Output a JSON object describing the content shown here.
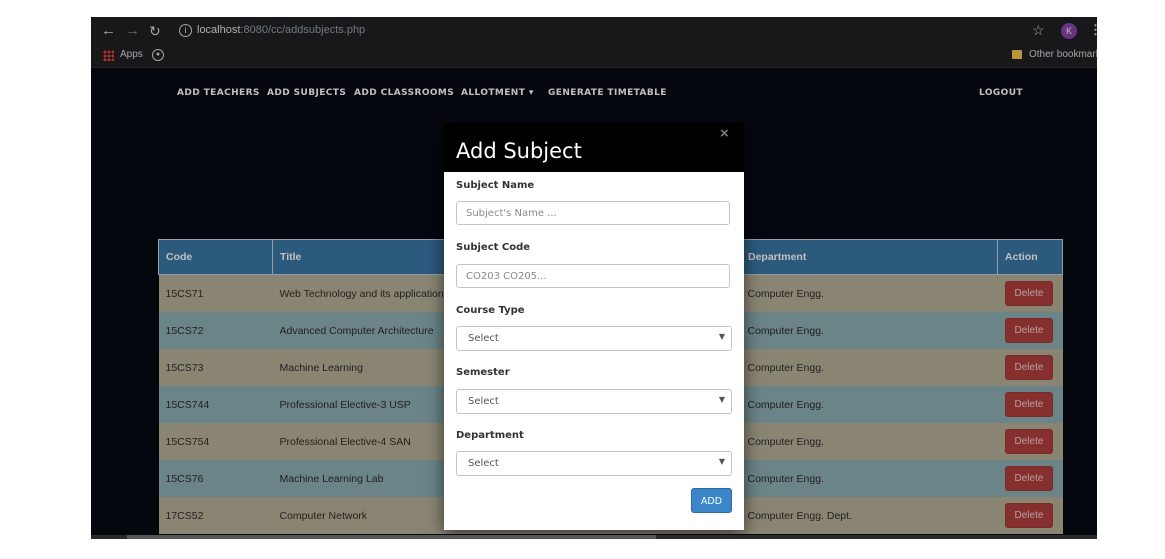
{
  "browser": {
    "url_host": "localhost",
    "url_path": ":8080/cc/addsubjects.php",
    "apps_label": "Apps",
    "other_bookmarks": "Other bookmarks",
    "avatar_letter": "K"
  },
  "nav": {
    "items": [
      "ADD TEACHERS",
      "ADD SUBJECTS",
      "ADD CLASSROOMS",
      "ALLOTMENT ▾",
      "GENERATE TIMETABLE"
    ],
    "logout": "LOGOUT"
  },
  "table": {
    "headers": [
      "Code",
      "Title",
      "Department",
      "Action"
    ],
    "rows": [
      {
        "code": "15CS71",
        "title": "Web Technology and its applications",
        "department": "Computer Engg.",
        "action": "Delete"
      },
      {
        "code": "15CS72",
        "title": "Advanced Computer Architecture",
        "department": "Computer Engg.",
        "action": "Delete"
      },
      {
        "code": "15CS73",
        "title": "Machine Learning",
        "department": "Computer Engg.",
        "action": "Delete"
      },
      {
        "code": "15CS744",
        "title": "Professional Elective-3 USP",
        "department": "Computer Engg.",
        "action": "Delete"
      },
      {
        "code": "15CS754",
        "title": "Professional Elective-4 SAN",
        "department": "Computer Engg.",
        "action": "Delete"
      },
      {
        "code": "15CS76",
        "title": "Machine Learning Lab",
        "department": "Computer Engg.",
        "action": "Delete"
      },
      {
        "code": "17CS52",
        "title": "Computer Network",
        "department": "Computer Engg. Dept.",
        "action": "Delete"
      }
    ]
  },
  "modal": {
    "title": "Add Subject",
    "close": "×",
    "subject_name_label": "Subject Name",
    "subject_name_placeholder": "Subject's Name ...",
    "subject_code_label": "Subject Code",
    "subject_code_placeholder": "CO203 CO205...",
    "course_type_label": "Course Type",
    "course_type_value": "Select",
    "semester_label": "Semester",
    "semester_value": "Select",
    "department_label": "Department",
    "department_value": "Select",
    "add_label": "ADD"
  },
  "colors": {
    "page_bg": "#070a15",
    "table_header": "#3b79a7",
    "row_tan": "#b9b29a",
    "row_teal": "#8fb0b5",
    "delete_button": "#b2403e",
    "add_button": "#3a86c8"
  }
}
